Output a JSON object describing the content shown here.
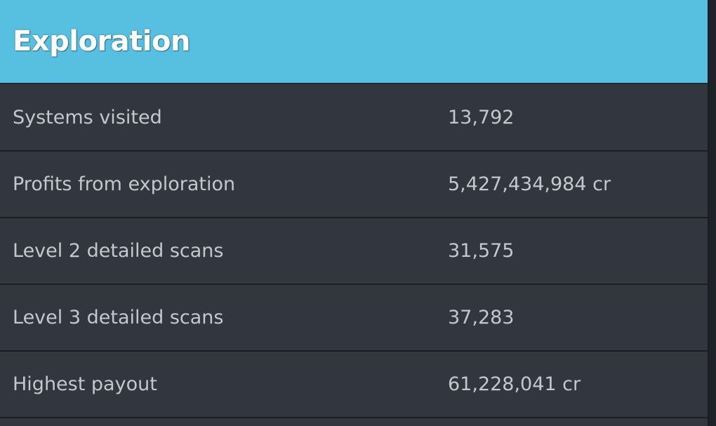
{
  "section": {
    "title": "Exploration"
  },
  "rows": [
    {
      "label": "Systems visited",
      "value": "13,792"
    },
    {
      "label": "Profits from exploration",
      "value": "5,427,434,984 cr"
    },
    {
      "label": "Level 2 detailed scans",
      "value": "31,575"
    },
    {
      "label": "Level 3 detailed scans",
      "value": "37,283"
    },
    {
      "label": "Highest payout",
      "value": "61,228,041 cr"
    }
  ],
  "colors": {
    "header_bg": "#57bfdf",
    "row_bg": "#32363e",
    "text": "#c3c7ce",
    "divider": "#1c1e22"
  }
}
